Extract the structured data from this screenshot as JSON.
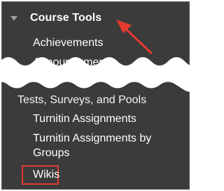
{
  "section": {
    "title": "Course Tools",
    "toggle_icon": "triangle-down-icon"
  },
  "items": {
    "achievements": "Achievements",
    "announcements": "Announcements",
    "tests": "Tests, Surveys, and Pools",
    "turnitin_assignments": "Turnitin Assignments",
    "turnitin_groups_line1": "Turnitin Assignments by",
    "turnitin_groups_line2": "Groups",
    "wikis": "Wikis"
  },
  "annotations": {
    "arrow_color": "#e23a2e",
    "highlight_color": "#e23a2e"
  },
  "colors": {
    "panel_bg": "#3b3b3b",
    "text": "#ffffff"
  }
}
